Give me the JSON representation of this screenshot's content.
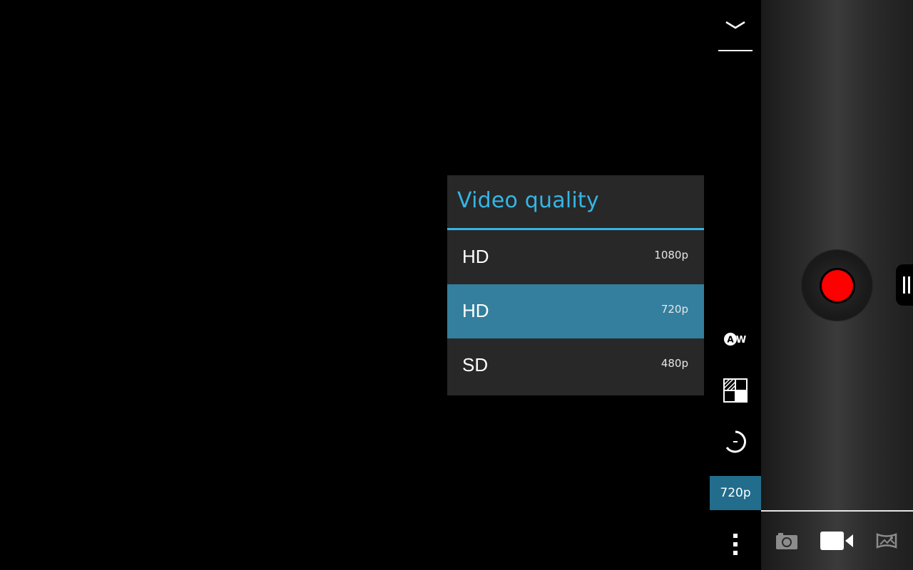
{
  "popup": {
    "title": "Video quality",
    "options": [
      {
        "label": "HD",
        "resolution": "1080p",
        "selected": false
      },
      {
        "label": "HD",
        "resolution": "720p",
        "selected": true
      },
      {
        "label": "SD",
        "resolution": "480p",
        "selected": false
      }
    ]
  },
  "settings_strip": {
    "quality_indicator": "720p",
    "wb_icon_text": "AW",
    "icons": [
      "chevron-down-icon",
      "white-balance-icon",
      "exposure-icon",
      "timer-icon",
      "overflow-menu-icon"
    ]
  },
  "panel": {
    "record_color": "#ff0000",
    "modes": [
      "camera-icon",
      "video-camera-icon",
      "panorama-icon"
    ],
    "active_mode": "video"
  },
  "colors": {
    "accent": "#35b5e5",
    "selected_option": "#337f9d",
    "quality_indicator_bg": "#226c8c"
  }
}
